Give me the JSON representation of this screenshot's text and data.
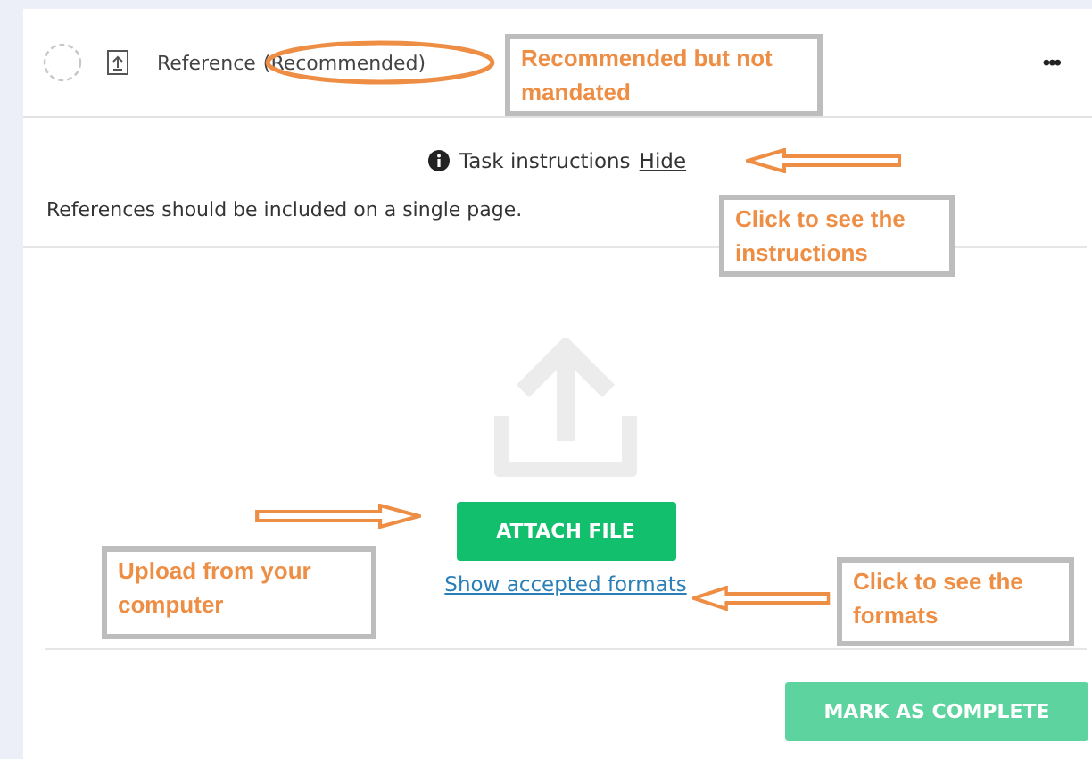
{
  "header": {
    "title": "Reference",
    "tag": "(Recommended)",
    "complete": false,
    "menu": "•••"
  },
  "instructions": {
    "label": "Task instructions",
    "toggle": "Hide",
    "text": "References should be included on a single page."
  },
  "upload": {
    "button": "ATTACH FILE",
    "link": "Show accepted formats"
  },
  "footer": {
    "button": "MARK AS COMPLETE",
    "disabled": true
  },
  "annotations": [
    {
      "kind": "ellipse"
    },
    {
      "kind": "box",
      "text": "Recommended but not mandated"
    },
    {
      "kind": "leftarrow"
    },
    {
      "kind": "box",
      "text": "Click to see the instructions"
    },
    {
      "kind": "rightarrow"
    },
    {
      "kind": "box",
      "text": "Upload from your computer"
    },
    {
      "kind": "leftarrow"
    },
    {
      "kind": "box",
      "text": "Click to see the formats"
    }
  ]
}
